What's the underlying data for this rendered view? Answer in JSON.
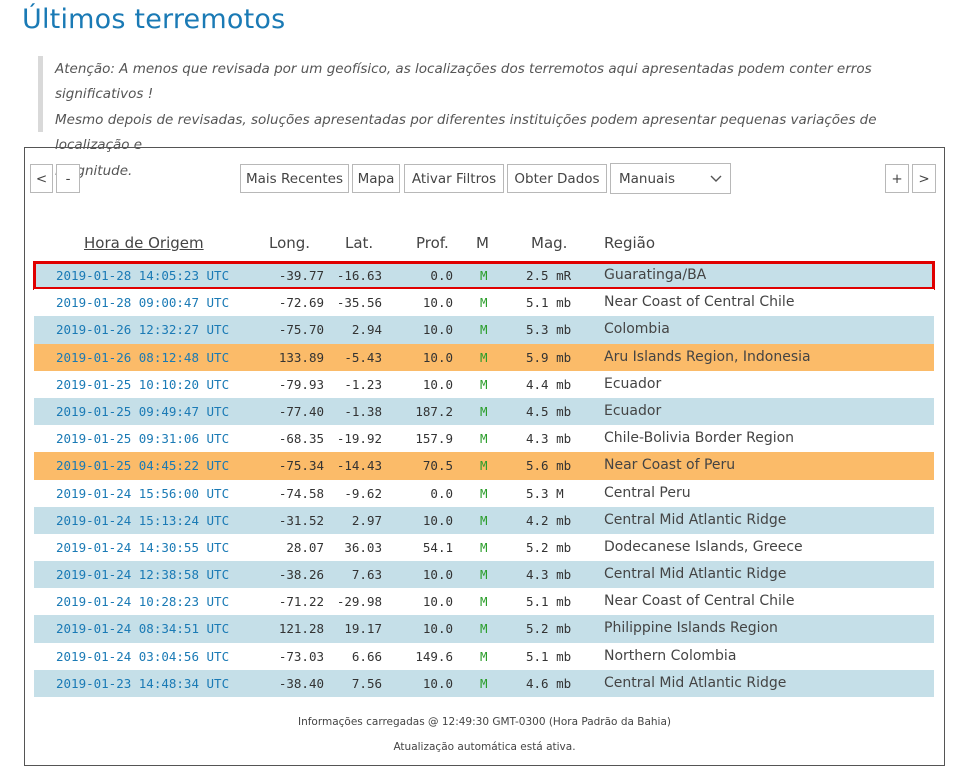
{
  "page": {
    "title": "Últimos terremotos",
    "notice_line1": "Atenção: A menos que revisada por um geofísico, as localizações dos terremotos aqui apresentadas podem conter erros significativos !",
    "notice_line2": "Mesmo depois de revisadas, soluções apresentadas por diferentes instituições podem apresentar pequenas variações de localização e",
    "notice_line3": "magnitude."
  },
  "toolbar": {
    "prev_label": "<",
    "minus_label": "-",
    "recent_label": "Mais Recentes",
    "map_label": "Mapa",
    "filters_label": "Ativar Filtros",
    "data_label": "Obter Dados",
    "mode_select_value": "Manuais",
    "plus_label": "+",
    "next_label": ">"
  },
  "table": {
    "headers": {
      "time": "Hora de Origem",
      "lon": "Long.",
      "lat": "Lat.",
      "depth": "Prof.",
      "mode": "M",
      "mag": "Mag.",
      "region": "Região"
    },
    "rows": [
      {
        "time": "2019-01-28 14:05:23 UTC",
        "lon": "-39.77",
        "lat": "-16.63",
        "depth": "0.0",
        "mode": "M",
        "mag": "2.5 mR",
        "region": "Guaratinga/BA"
      },
      {
        "time": "2019-01-28 09:00:47 UTC",
        "lon": "-72.69",
        "lat": "-35.56",
        "depth": "10.0",
        "mode": "M",
        "mag": "5.1 mb",
        "region": "Near Coast of Central Chile"
      },
      {
        "time": "2019-01-26 12:32:27 UTC",
        "lon": "-75.70",
        "lat": "2.94",
        "depth": "10.0",
        "mode": "M",
        "mag": "5.3 mb",
        "region": "Colombia"
      },
      {
        "time": "2019-01-26 08:12:48 UTC",
        "lon": "133.89",
        "lat": "-5.43",
        "depth": "10.0",
        "mode": "M",
        "mag": "5.9 mb",
        "region": "Aru Islands Region, Indonesia"
      },
      {
        "time": "2019-01-25 10:10:20 UTC",
        "lon": "-79.93",
        "lat": "-1.23",
        "depth": "10.0",
        "mode": "M",
        "mag": "4.4 mb",
        "region": "Ecuador"
      },
      {
        "time": "2019-01-25 09:49:47 UTC",
        "lon": "-77.40",
        "lat": "-1.38",
        "depth": "187.2",
        "mode": "M",
        "mag": "4.5 mb",
        "region": "Ecuador"
      },
      {
        "time": "2019-01-25 09:31:06 UTC",
        "lon": "-68.35",
        "lat": "-19.92",
        "depth": "157.9",
        "mode": "M",
        "mag": "4.3 mb",
        "region": "Chile-Bolivia Border Region"
      },
      {
        "time": "2019-01-25 04:45:22 UTC",
        "lon": "-75.34",
        "lat": "-14.43",
        "depth": "70.5",
        "mode": "M",
        "mag": "5.6 mb",
        "region": "Near Coast of Peru"
      },
      {
        "time": "2019-01-24 15:56:00 UTC",
        "lon": "-74.58",
        "lat": "-9.62",
        "depth": "0.0",
        "mode": "M",
        "mag": "5.3 M",
        "region": "Central Peru"
      },
      {
        "time": "2019-01-24 15:13:24 UTC",
        "lon": "-31.52",
        "lat": "2.97",
        "depth": "10.0",
        "mode": "M",
        "mag": "4.2 mb",
        "region": "Central Mid Atlantic Ridge"
      },
      {
        "time": "2019-01-24 14:30:55 UTC",
        "lon": "28.07",
        "lat": "36.03",
        "depth": "54.1",
        "mode": "M",
        "mag": "5.2 mb",
        "region": "Dodecanese Islands, Greece"
      },
      {
        "time": "2019-01-24 12:38:58 UTC",
        "lon": "-38.26",
        "lat": "7.63",
        "depth": "10.0",
        "mode": "M",
        "mag": "4.3 mb",
        "region": "Central Mid Atlantic Ridge"
      },
      {
        "time": "2019-01-24 10:28:23 UTC",
        "lon": "-71.22",
        "lat": "-29.98",
        "depth": "10.0",
        "mode": "M",
        "mag": "5.1 mb",
        "region": "Near Coast of Central Chile"
      },
      {
        "time": "2019-01-24 08:34:51 UTC",
        "lon": "121.28",
        "lat": "19.17",
        "depth": "10.0",
        "mode": "M",
        "mag": "5.2 mb",
        "region": "Philippine Islands Region"
      },
      {
        "time": "2019-01-24 03:04:56 UTC",
        "lon": "-73.03",
        "lat": "6.66",
        "depth": "149.6",
        "mode": "M",
        "mag": "5.1 mb",
        "region": "Northern Colombia"
      },
      {
        "time": "2019-01-23 14:48:34 UTC",
        "lon": "-38.40",
        "lat": "7.56",
        "depth": "10.0",
        "mode": "M",
        "mag": "4.6 mb",
        "region": "Central Mid Atlantic Ridge"
      }
    ]
  },
  "footer": {
    "loaded_info": "Informações carregadas @ 12:49:30 GMT-0300 (Hora Padrão da Bahia)",
    "auto_update": "Atualização automática está ativa."
  },
  "colors": {
    "accent": "#1a7ab5",
    "row_blue": "#c5dfe8",
    "row_orange": "#fbbb69",
    "highlight": "#e00000",
    "mode_green": "#2a9d2a"
  }
}
